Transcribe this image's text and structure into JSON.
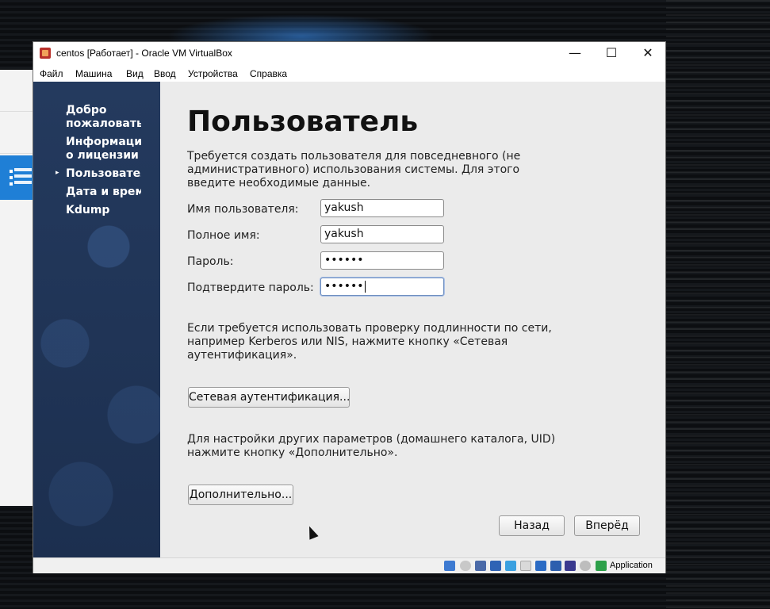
{
  "window": {
    "title": "centos [Работает] - Oracle VM VirtualBox",
    "minimize_glyph": "—",
    "maximize_glyph": "☐",
    "close_glyph": "✕"
  },
  "menu": {
    "items": [
      {
        "label": "Файл"
      },
      {
        "label": "Машина"
      },
      {
        "label": "Вид"
      },
      {
        "label": "Ввод"
      },
      {
        "label": "Устройства"
      },
      {
        "label": "Справка"
      }
    ]
  },
  "sidebar": {
    "items": [
      {
        "label": "Добро\nпожаловать",
        "active": false
      },
      {
        "label": "Информация\nо лицензии",
        "active": false
      },
      {
        "label": "Пользователь",
        "active": true
      },
      {
        "label": "Дата и время",
        "active": false
      },
      {
        "label": "Kdump",
        "active": false
      }
    ],
    "active_marker": "▸"
  },
  "content": {
    "heading": "Пользователь",
    "intro": "Требуется создать пользователя для повседневного (не административного) использования системы. Для этого введите необходимые данные.",
    "fields": [
      {
        "label": "Имя пользователя:",
        "value": "yakush"
      },
      {
        "label": "Полное имя:",
        "value": "yakush"
      },
      {
        "label": "Пароль:",
        "value": "••••••"
      },
      {
        "label": "Подтвердите пароль:",
        "value": "••••••"
      }
    ],
    "network_text": "Если требуется использовать проверку подлинности по сети, например Kerberos или NIS, нажмите кнопку «Сетевая аутентификация».",
    "network_button": "Сетевая аутентификация...",
    "advanced_text": "Для настройки других параметров (домашнего каталога, UID) нажмите кнопку «Дополнительно».",
    "advanced_button": "Дополнительно...",
    "back_button": "Назад",
    "forward_button": "Вперёд"
  },
  "statusbar": {
    "icons": [
      "hard-disk-icon",
      "optical-disk-icon",
      "audio-icon",
      "network-icon",
      "usb-icon",
      "shared-folders-icon",
      "display-icon",
      "video-capture-icon",
      "cpu-icon",
      "mouse-integration-icon",
      "keyboard-icon"
    ],
    "host_key_label": "Application"
  }
}
